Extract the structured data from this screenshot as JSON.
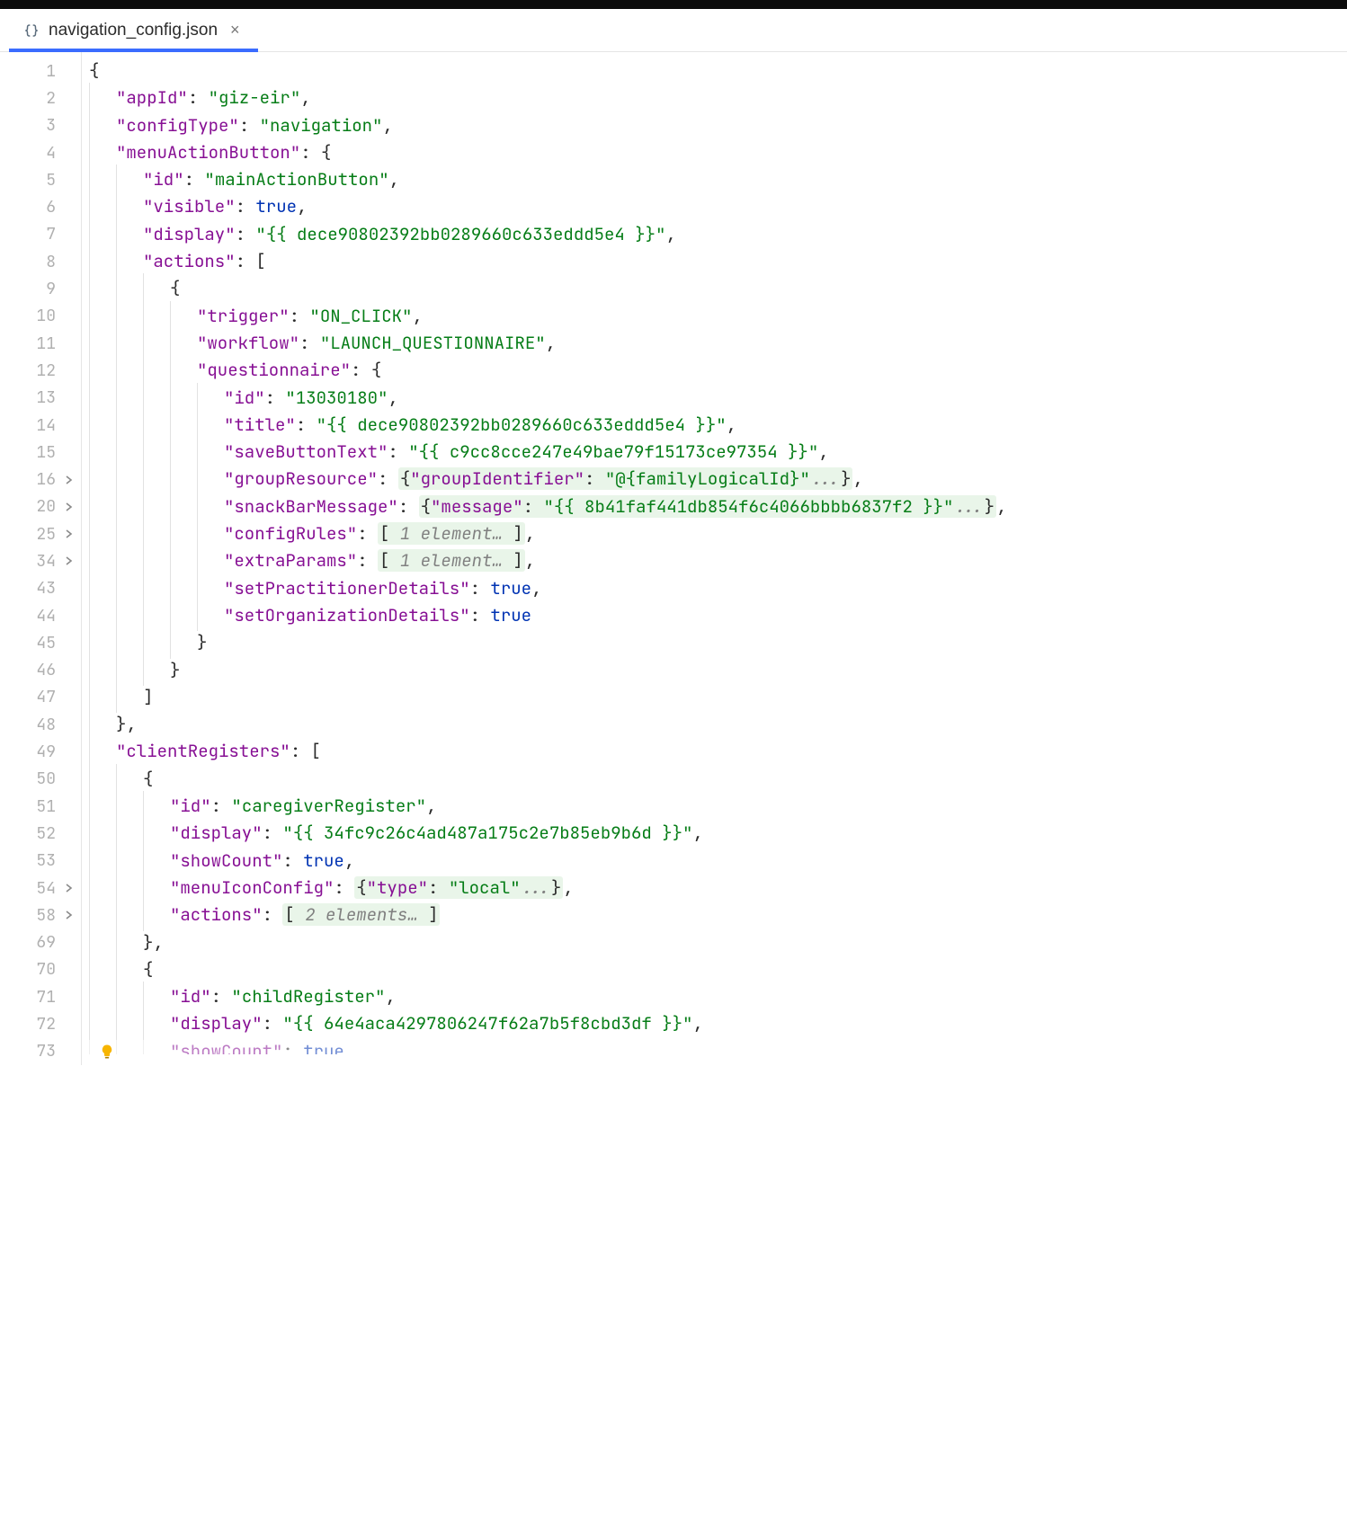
{
  "tab": {
    "title": "navigation_config.json",
    "close_glyph": "×",
    "icon_name": "json-file-icon"
  },
  "gutter": {
    "lines": [
      {
        "n": "1"
      },
      {
        "n": "2"
      },
      {
        "n": "3"
      },
      {
        "n": "4"
      },
      {
        "n": "5"
      },
      {
        "n": "6"
      },
      {
        "n": "7"
      },
      {
        "n": "8"
      },
      {
        "n": "9"
      },
      {
        "n": "10"
      },
      {
        "n": "11"
      },
      {
        "n": "12"
      },
      {
        "n": "13"
      },
      {
        "n": "14"
      },
      {
        "n": "15"
      },
      {
        "n": "16",
        "fold": true
      },
      {
        "n": "20",
        "fold": true
      },
      {
        "n": "25",
        "fold": true
      },
      {
        "n": "34",
        "fold": true
      },
      {
        "n": "43"
      },
      {
        "n": "44"
      },
      {
        "n": "45"
      },
      {
        "n": "46"
      },
      {
        "n": "47"
      },
      {
        "n": "48"
      },
      {
        "n": "49"
      },
      {
        "n": "50"
      },
      {
        "n": "51"
      },
      {
        "n": "52"
      },
      {
        "n": "53"
      },
      {
        "n": "54",
        "fold": true
      },
      {
        "n": "58",
        "fold": true
      },
      {
        "n": "69"
      },
      {
        "n": "70"
      },
      {
        "n": "71"
      },
      {
        "n": "72"
      },
      {
        "n": "73",
        "bulb": true
      }
    ]
  },
  "code": {
    "l1": {
      "open": "{"
    },
    "l2": {
      "key": "\"appId\"",
      "colon": ": ",
      "val": "\"giz-eir\"",
      "comma": ","
    },
    "l3": {
      "key": "\"configType\"",
      "colon": ": ",
      "val": "\"navigation\"",
      "comma": ","
    },
    "l4": {
      "key": "\"menuActionButton\"",
      "colon": ": ",
      "open": "{"
    },
    "l5": {
      "key": "\"id\"",
      "colon": ": ",
      "val": "\"mainActionButton\"",
      "comma": ","
    },
    "l6": {
      "key": "\"visible\"",
      "colon": ": ",
      "val": "true",
      "comma": ","
    },
    "l7": {
      "key": "\"display\"",
      "colon": ": ",
      "val": "\"{{ dece90802392bb0289660c633eddd5e4 }}\"",
      "comma": ","
    },
    "l8": {
      "key": "\"actions\"",
      "colon": ": ",
      "open": "["
    },
    "l9": {
      "open": "{"
    },
    "l10": {
      "key": "\"trigger\"",
      "colon": ": ",
      "val": "\"ON_CLICK\"",
      "comma": ","
    },
    "l11": {
      "key": "\"workflow\"",
      "colon": ": ",
      "val": "\"LAUNCH_QUESTIONNAIRE\"",
      "comma": ","
    },
    "l12": {
      "key": "\"questionnaire\"",
      "colon": ": ",
      "open": "{"
    },
    "l13": {
      "key": "\"id\"",
      "colon": ": ",
      "val": "\"13030180\"",
      "comma": ","
    },
    "l14": {
      "key": "\"title\"",
      "colon": ": ",
      "val": "\"{{ dece90802392bb0289660c633eddd5e4 }}\"",
      "comma": ","
    },
    "l15": {
      "key": "\"saveButtonText\"",
      "colon": ": ",
      "val": "\"{{ c9cc8cce247e49bae79f15173ce97354 }}\"",
      "comma": ","
    },
    "l16": {
      "key": "\"groupResource\"",
      "colon": ": ",
      "fold_open": "{",
      "fk": "\"groupIdentifier\"",
      "fc": ": ",
      "fv": "\"@{familyLogicalId}\"",
      "fe": "...}",
      "comma": ","
    },
    "l20": {
      "key": "\"snackBarMessage\"",
      "colon": ": ",
      "fold_open": "{",
      "fk": "\"message\"",
      "fc": ": ",
      "fv": "\"{{ 8b41faf441db854f6c4066bbbb6837f2 }}\"",
      "fe": "...}",
      "comma": ","
    },
    "l25": {
      "key": "\"configRules\"",
      "colon": ": ",
      "fold": "[ 1 element… ]",
      "comma": ","
    },
    "l34": {
      "key": "\"extraParams\"",
      "colon": ": ",
      "fold": "[ 1 element… ]",
      "comma": ","
    },
    "l43": {
      "key": "\"setPractitionerDetails\"",
      "colon": ": ",
      "val": "true",
      "comma": ","
    },
    "l44": {
      "key": "\"setOrganizationDetails\"",
      "colon": ": ",
      "val": "true"
    },
    "l45": {
      "close": "}"
    },
    "l46": {
      "close": "}"
    },
    "l47": {
      "close": "]"
    },
    "l48": {
      "close": "}",
      "comma": ","
    },
    "l49": {
      "key": "\"clientRegisters\"",
      "colon": ": ",
      "open": "["
    },
    "l50": {
      "open": "{"
    },
    "l51": {
      "key": "\"id\"",
      "colon": ": ",
      "val": "\"caregiverRegister\"",
      "comma": ","
    },
    "l52": {
      "key": "\"display\"",
      "colon": ": ",
      "val": "\"{{ 34fc9c26c4ad487a175c2e7b85eb9b6d }}\"",
      "comma": ","
    },
    "l53": {
      "key": "\"showCount\"",
      "colon": ": ",
      "val": "true",
      "comma": ","
    },
    "l54": {
      "key": "\"menuIconConfig\"",
      "colon": ": ",
      "fold_open": "{",
      "fk": "\"type\"",
      "fc": ": ",
      "fv": "\"local\"",
      "fe": "...}",
      "comma": ","
    },
    "l58": {
      "key": "\"actions\"",
      "colon": ": ",
      "fold": "[ 2 elements… ]"
    },
    "l69": {
      "close": "}",
      "comma": ","
    },
    "l70": {
      "open": "{"
    },
    "l71": {
      "key": "\"id\"",
      "colon": ": ",
      "val": "\"childRegister\"",
      "comma": ","
    },
    "l72": {
      "key": "\"display\"",
      "colon": ": ",
      "val": "\"{{ 64e4aca4297806247f62a7b5f8cbd3df }}\"",
      "comma": ","
    },
    "l73": {
      "key": "\"showCount\"",
      "colon": ": ",
      "val": "true"
    }
  }
}
